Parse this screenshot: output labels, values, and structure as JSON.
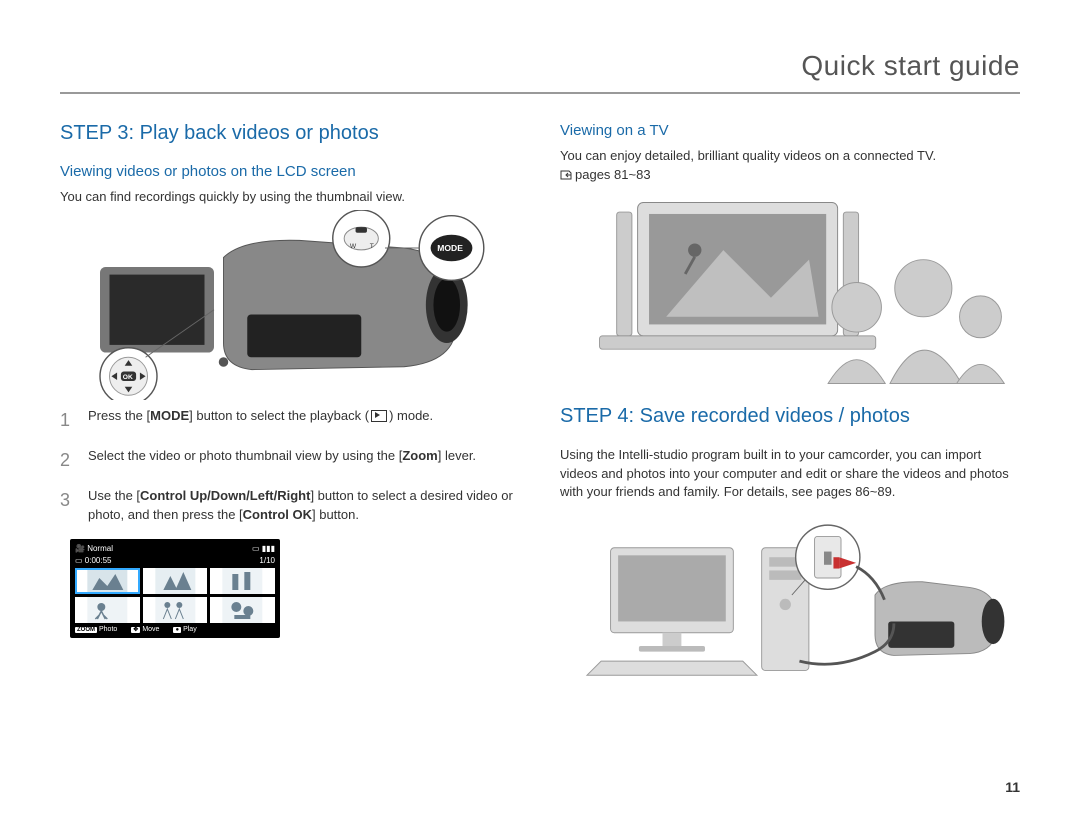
{
  "header": {
    "title": "Quick start guide"
  },
  "left": {
    "step_title": "STEP 3: Play back videos or photos",
    "sub_title": "Viewing videos or photos on the LCD screen",
    "intro": "You can find recordings quickly by using the thumbnail view.",
    "camcorder_labels": {
      "mode": "MODE",
      "ok": "OK",
      "w": "W",
      "t": "T"
    },
    "steps": [
      {
        "n": "1",
        "text_pre": "Press the [",
        "bold1": "MODE",
        "text_mid": "] button to select the playback (",
        "text_post": ") mode."
      },
      {
        "n": "2",
        "text_pre": "Select the video or photo thumbnail view by using the [",
        "bold1": "Zoom",
        "text_post": "] lever."
      },
      {
        "n": "3",
        "text_pre": "Use the [",
        "bold1": "Control Up/Down/Left/Right",
        "text_mid": "] button to select a desired video or photo, and then press the [",
        "bold2": "Control OK",
        "text_post": "] button."
      }
    ],
    "preview": {
      "top_left": "Normal",
      "time": "0:00:55",
      "count": "1/10",
      "bottom_photo_label": "Photo",
      "bottom_photo_prefix": "ZOOM",
      "bottom_move": "Move",
      "bottom_play": "Play"
    }
  },
  "right": {
    "tv_title": "Viewing on a TV",
    "tv_text": "You can enjoy detailed, brilliant quality videos on a connected TV.",
    "tv_ref": "pages 81~83",
    "step4_title": "STEP 4: Save recorded videos / photos",
    "step4_text": "Using the Intelli-studio program built in to your camcorder, you can import videos and photos into your computer and edit or share the videos and photos with your friends and family. For details, see pages 86~89."
  },
  "page_number": "11"
}
